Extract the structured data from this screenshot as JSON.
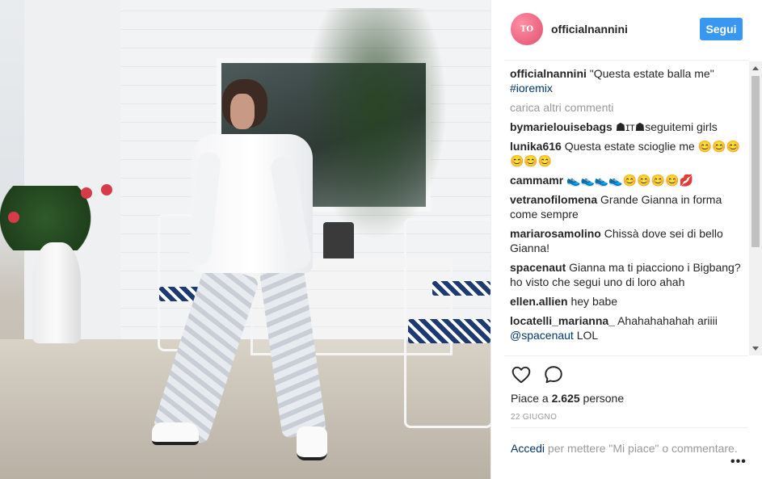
{
  "post": {
    "username": "officialnannini",
    "follow_label": "Segui",
    "avatar_text": "TO"
  },
  "caption": {
    "user": "officialnannini",
    "text": "\"Questa estate balla me\"",
    "hashtag": "#ioremix"
  },
  "load_more": "carica altri commenti",
  "comments": [
    {
      "user": "bymarielouisebags",
      "text": "☗ɪᴛ☗seguitemi girls"
    },
    {
      "user": "lunika616",
      "text": "Questa estate scioglie me 😊😊😊😊😊😊"
    },
    {
      "user": "cammamr",
      "text": "👟👟👟👟😊😊😊😊💋"
    },
    {
      "user": "vetranofilomena",
      "text": "Grande Gianna in forma come sempre"
    },
    {
      "user": "mariarosamolino",
      "text": "Chissà dove sei di bello Gianna!"
    },
    {
      "user": "spacenaut",
      "text": "Gianna ma ti piacciono i Bigbang? ho visto che segui uno di loro ahah"
    },
    {
      "user": "ellen.allien",
      "text": "hey babe"
    },
    {
      "user": "locatelli_marianna_",
      "text": "Ahahahahahah ariiii",
      "mention": "@spacenaut",
      "after": "LOL"
    }
  ],
  "likes": {
    "prefix": "Piace a ",
    "count": "2.625",
    "suffix": " persone"
  },
  "date": "22 GIUGNO",
  "login": {
    "link": "Accedi",
    "text": " per mettere \"Mi piace\" o commentare."
  },
  "more_label": "•••",
  "icons": {
    "like": "heart-outline-icon",
    "comment": "speech-bubble-icon",
    "more": "ellipsis-icon"
  },
  "colors": {
    "accent": "#3897f0",
    "link": "#003569",
    "muted": "#999999"
  }
}
